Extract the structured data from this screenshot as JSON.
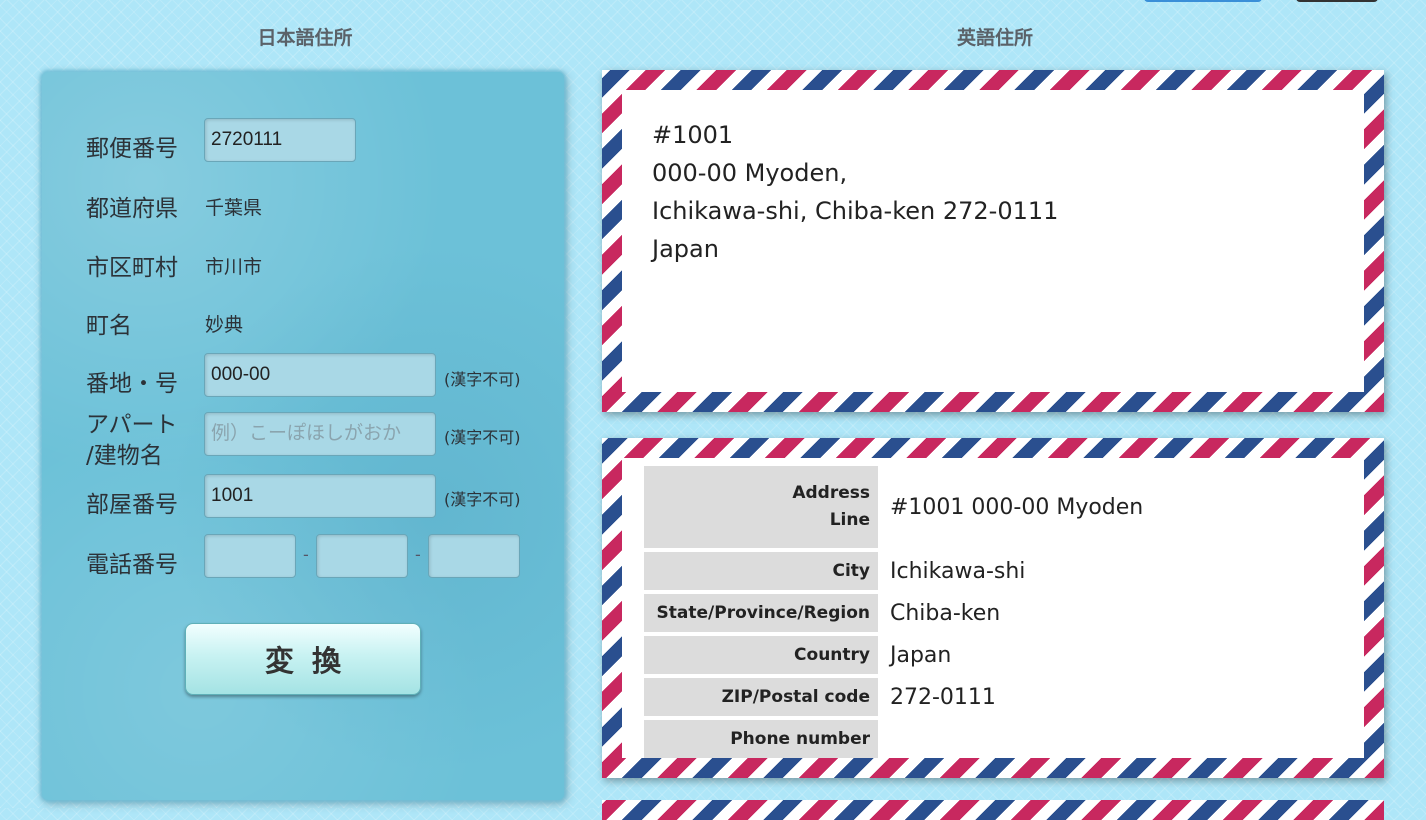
{
  "headings": {
    "japanese": "日本語住所",
    "english": "英語住所"
  },
  "form": {
    "postal_code": {
      "label": "郵便番号",
      "value": "2720111"
    },
    "prefecture": {
      "label": "都道府県",
      "value": "千葉県"
    },
    "city": {
      "label": "市区町村",
      "value": "市川市"
    },
    "town": {
      "label": "町名",
      "value": "妙典"
    },
    "banchi": {
      "label": "番地・号",
      "value": "000-00",
      "note": "(漢字不可)"
    },
    "building": {
      "label_line1": "アパート",
      "label_line2": "/建物名",
      "value": "",
      "placeholder": "例）こーぽほしがおか",
      "note": "(漢字不可)"
    },
    "room": {
      "label": "部屋番号",
      "value": "1001",
      "note": "(漢字不可)"
    },
    "phone": {
      "label": "電話番号",
      "part1": "",
      "part2": "",
      "part3": "",
      "separator": "-"
    },
    "convert_button": "変換"
  },
  "english_address": {
    "line1": "#1001",
    "line2": "000-00 Myoden,",
    "line3": "Ichikawa-shi, Chiba-ken 272-0111",
    "line4": "Japan"
  },
  "english_table": {
    "rows": [
      {
        "label_line1": "Address",
        "label_line2": "Line",
        "value": "#1001 000-00 Myoden"
      },
      {
        "label": "City",
        "value": "Ichikawa-shi"
      },
      {
        "label": "State/Province/Region",
        "value": "Chiba-ken"
      },
      {
        "label": "Country",
        "value": "Japan"
      },
      {
        "label": "ZIP/Postal code",
        "value": "272-0111"
      },
      {
        "label": "Phone number",
        "value": ""
      }
    ]
  },
  "colors": {
    "background": "#aee6f8",
    "panel": "#6cc1d8",
    "airmail_red": "#c8285f",
    "airmail_blue": "#2a4f8f"
  }
}
